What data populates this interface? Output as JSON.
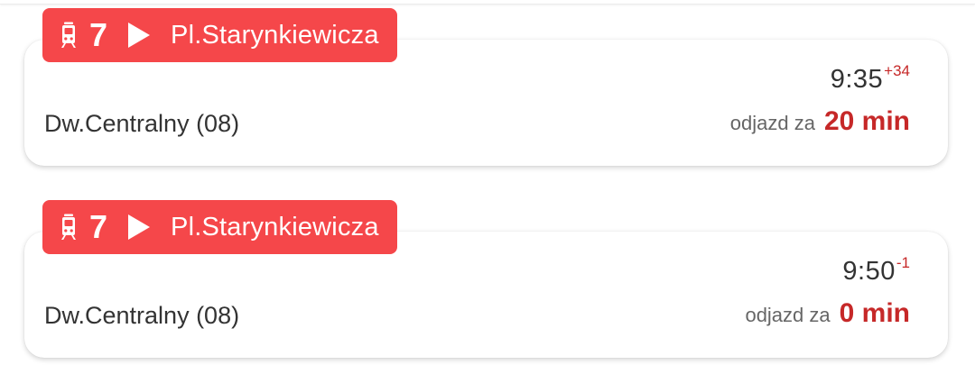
{
  "colors": {
    "badge_bg": "#f5474a",
    "delay_text": "#c62828",
    "countdown_value": "#c62828"
  },
  "departures": [
    {
      "icon": "tram-icon",
      "direction_icon": "play-icon",
      "line": "7",
      "destination": "Pl.Starynkiewicza",
      "stop": "Dw.Centralny (08)",
      "scheduled_time": "9:35",
      "delay": "+34",
      "countdown_label": "odjazd za",
      "countdown_value": "20 min"
    },
    {
      "icon": "tram-icon",
      "direction_icon": "play-icon",
      "line": "7",
      "destination": "Pl.Starynkiewicza",
      "stop": "Dw.Centralny (08)",
      "scheduled_time": "9:50",
      "delay": "-1",
      "countdown_label": "odjazd za",
      "countdown_value": "0 min"
    }
  ]
}
